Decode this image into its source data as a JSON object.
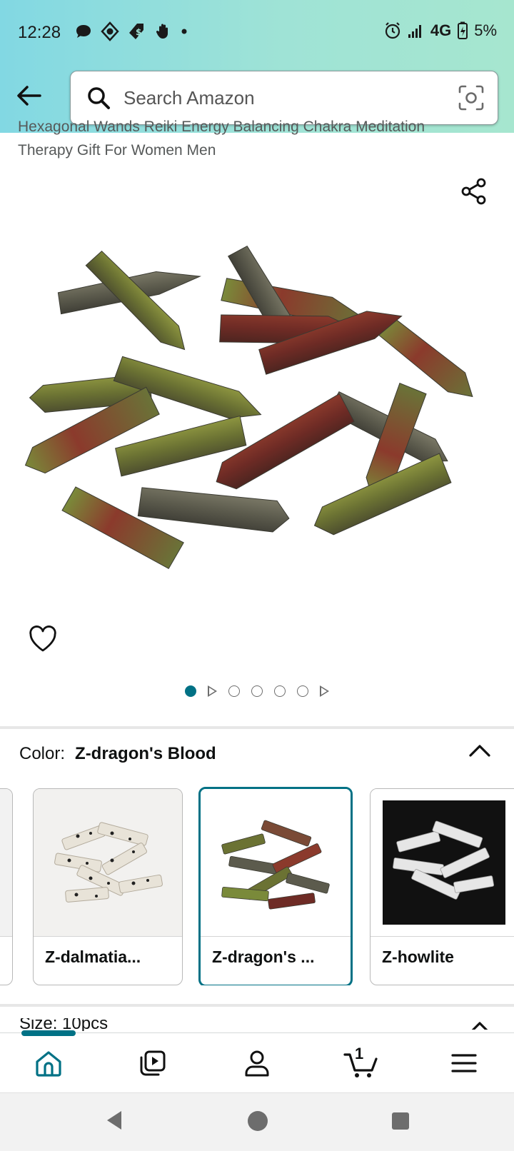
{
  "status_bar": {
    "time": "12:28",
    "network": "4G",
    "battery": "5%"
  },
  "search": {
    "placeholder": "Search Amazon"
  },
  "product": {
    "title_partial_line1": "Hexagonal Wands Reiki Energy Balancing Chakra Meditation",
    "title_line2": "Therapy Gift For Women Men",
    "image_count": 6,
    "current_image_index": 0
  },
  "variation": {
    "color_label": "Color:",
    "color_value": "Z-dragon's Blood",
    "swatches": [
      {
        "label": "Z-dalmatia..."
      },
      {
        "label": "Z-dragon's ..."
      },
      {
        "label": "Z-howlite"
      }
    ],
    "size_label_partial": "Size: 10pcs"
  },
  "bottom_nav": {
    "items": [
      "home",
      "inspire",
      "account",
      "cart",
      "menu"
    ],
    "cart_count": "1"
  },
  "colors": {
    "accent": "#007185",
    "header_gradient_start": "#82d8e3",
    "header_gradient_end": "#a6e6cf"
  }
}
